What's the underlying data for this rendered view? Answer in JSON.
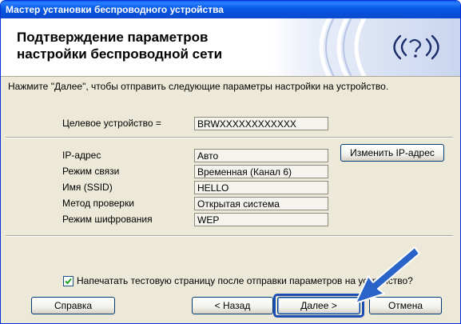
{
  "window": {
    "title": "Мастер установки беспроводного устройства"
  },
  "header": {
    "title_line1": "Подтверждение параметров",
    "title_line2": "настройки беспроводной сети"
  },
  "instruction": "Нажмите \"Далее\", чтобы отправить следующие параметры настройки на устройство.",
  "target": {
    "label": "Целевое устройство =",
    "value": "BRWXXXXXXXXXXXX"
  },
  "settings": [
    {
      "label": "IP-адрес",
      "value": "Авто"
    },
    {
      "label": "Режим связи",
      "value": "Временная (Канал 6)"
    },
    {
      "label": "Имя (SSID)",
      "value": "HELLO"
    },
    {
      "label": "Метод проверки",
      "value": "Открытая система"
    },
    {
      "label": "Режим шифрования",
      "value": "WEP"
    }
  ],
  "change_ip_button": "Изменить IP-адрес",
  "print_checkbox": {
    "label": "Напечатать тестовую страницу после отправки параметров на устройство?",
    "checked": true
  },
  "buttons": {
    "help": "Справка",
    "back": "< Назад",
    "next": "Далее >",
    "cancel": "Отмена"
  },
  "colors": {
    "titlebar": "#0a5ce8",
    "accent_arrow": "#2b64c8",
    "dialog_bg": "#ece9d8"
  }
}
